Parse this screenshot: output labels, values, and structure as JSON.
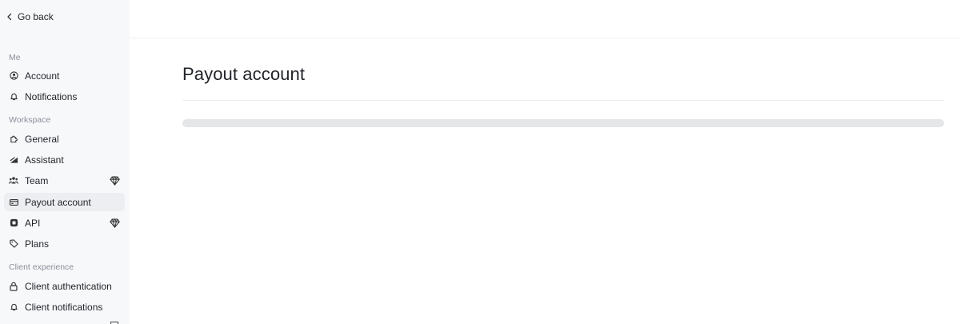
{
  "sidebar": {
    "go_back": "Go back",
    "sections": {
      "me": "Me",
      "workspace": "Workspace",
      "client_experience": "Client experience"
    },
    "items": [
      {
        "label": "Account",
        "icon": "user-circle-icon"
      },
      {
        "label": "Notifications",
        "icon": "bell-icon"
      },
      {
        "label": "General",
        "icon": "puzzle-icon"
      },
      {
        "label": "Assistant",
        "icon": "signal-icon"
      },
      {
        "label": "Team",
        "icon": "team-icon",
        "premium": true
      },
      {
        "label": "Payout account",
        "icon": "credit-card-icon",
        "active": true
      },
      {
        "label": "API",
        "icon": "chip-icon",
        "premium": true
      },
      {
        "label": "Plans",
        "icon": "tag-icon"
      },
      {
        "label": "Client authentication",
        "icon": "lock-icon"
      },
      {
        "label": "Client notifications",
        "icon": "bell-icon"
      }
    ]
  },
  "main": {
    "title": "Payout account",
    "loading_progress": 0
  },
  "colors": {
    "sidebar_bg": "#f7f8fa",
    "active_bg": "#eceef1",
    "skeleton": "#e5e6e8"
  }
}
